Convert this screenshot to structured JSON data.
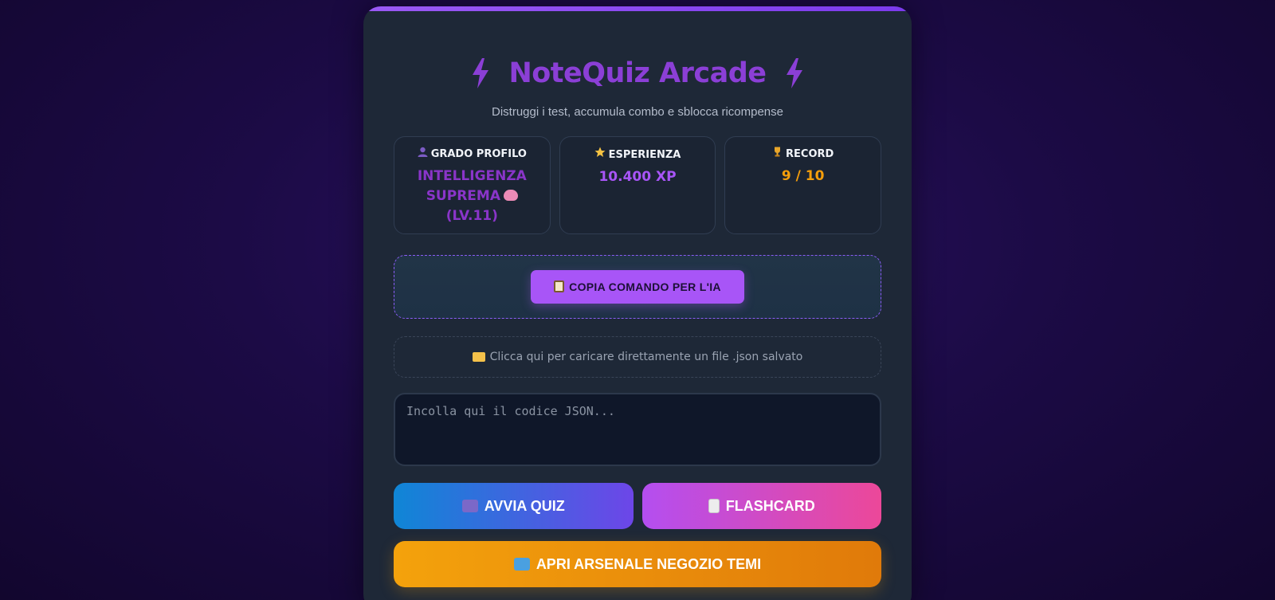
{
  "header": {
    "title": "NoteQuiz Arcade",
    "subtitle": "Distruggi i test, accumula combo e sblocca ricompense"
  },
  "stats": {
    "profile": {
      "label": "GRADO PROFILO",
      "value": "INTELLIGENZA SUPREMA",
      "level": "(LV.11)"
    },
    "experience": {
      "label": "ESPERIENZA",
      "value": "10.400 XP"
    },
    "record": {
      "label": "RECORD",
      "value": "9 / 10"
    }
  },
  "prompt": {
    "copy_label": "COPIA COMANDO PER L'IA"
  },
  "upload": {
    "label": "Clicca qui per caricare direttamente un file .json salvato"
  },
  "json_input": {
    "placeholder": "Incolla qui il codice JSON...",
    "value": ""
  },
  "actions": {
    "quiz_label": "AVVIA QUIZ",
    "flashcard_label": "FLASHCARD",
    "shop_label": "APRI ARSENALE NEGOZIO TEMI"
  },
  "colors": {
    "accent": "#a855f7",
    "title": "#8b3fd6",
    "record": "#f59e0b",
    "card_bg": "#1e2837"
  }
}
